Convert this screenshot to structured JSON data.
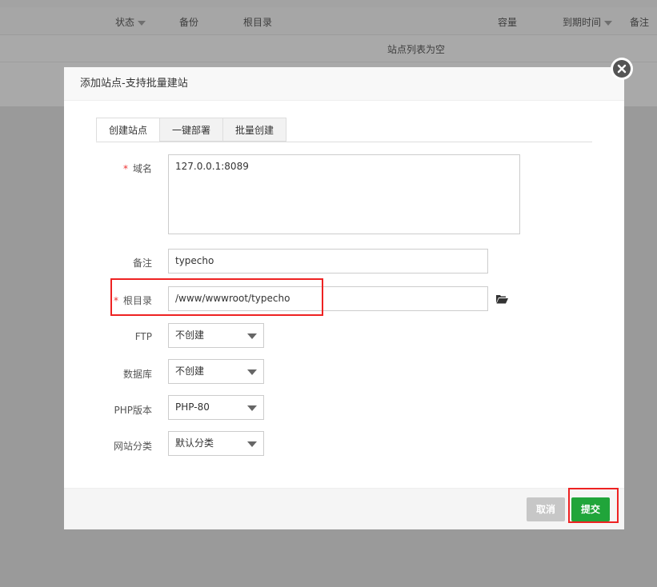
{
  "background": {
    "headers": [
      {
        "label": "状态",
        "sortable": true
      },
      {
        "label": "备份",
        "sortable": false
      },
      {
        "label": "根目录",
        "sortable": false
      },
      {
        "label": "容量",
        "sortable": false
      },
      {
        "label": "到期时间",
        "sortable": true
      },
      {
        "label": "备注",
        "sortable": false
      }
    ],
    "empty_text": "站点列表为空"
  },
  "modal": {
    "title": "添加站点-支持批量建站",
    "tabs": [
      {
        "label": "创建站点",
        "active": true
      },
      {
        "label": "一键部署",
        "active": false
      },
      {
        "label": "批量创建",
        "active": false
      }
    ],
    "fields": {
      "domain": {
        "label": "域名",
        "required": true,
        "value": "127.0.0.1:8089"
      },
      "note": {
        "label": "备注",
        "value": "typecho"
      },
      "root": {
        "label": "根目录",
        "required": true,
        "value": "/www/wwwroot/typecho",
        "icon": "folder-open-icon"
      },
      "ftp": {
        "label": "FTP",
        "value": "不创建"
      },
      "database": {
        "label": "数据库",
        "value": "不创建"
      },
      "php": {
        "label": "PHP版本",
        "value": "PHP-80"
      },
      "category": {
        "label": "网站分类",
        "value": "默认分类"
      }
    },
    "buttons": {
      "cancel": "取消",
      "submit": "提交"
    }
  },
  "colors": {
    "submit": "#20a53a",
    "cancel": "#c7c7c7",
    "required_star": "#ee3333",
    "highlight": "#ee2222"
  }
}
